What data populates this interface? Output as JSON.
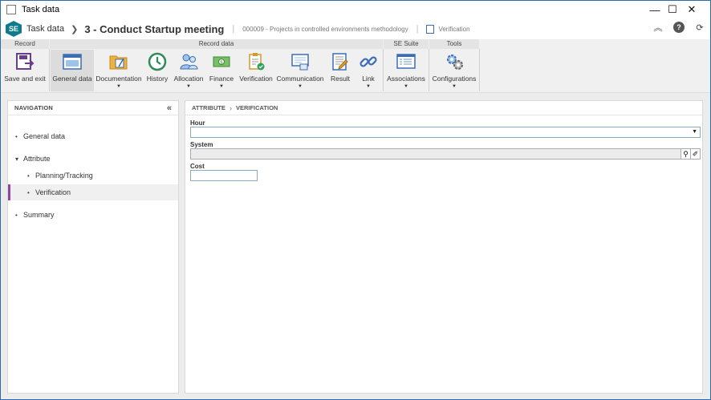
{
  "window": {
    "title": "Task data",
    "controls": {
      "minimize": "—",
      "maximize": "☐",
      "close": "✕"
    }
  },
  "header": {
    "logo_text": "SE",
    "section": "Task data",
    "task_title": "3 - Conduct Startup meeting",
    "project": "000009 - Projects in controlled environments methodology",
    "current_view": "Verification",
    "icons": {
      "collapse": "︽",
      "help": "?",
      "refresh": "⟳"
    }
  },
  "ribbon": {
    "groups": [
      {
        "label": "Record"
      },
      {
        "label": "Record data"
      },
      {
        "label": "SE Suite"
      },
      {
        "label": "Tools"
      }
    ],
    "buttons": [
      {
        "label": "Save and exit",
        "icon": "save-exit-icon",
        "dropdown": false
      },
      {
        "label": "General data",
        "icon": "general-data-icon",
        "dropdown": false,
        "active": true
      },
      {
        "label": "Documentation",
        "icon": "documentation-icon",
        "dropdown": true
      },
      {
        "label": "History",
        "icon": "history-icon",
        "dropdown": false
      },
      {
        "label": "Allocation",
        "icon": "allocation-icon",
        "dropdown": true
      },
      {
        "label": "Finance",
        "icon": "finance-icon",
        "dropdown": true
      },
      {
        "label": "Verification",
        "icon": "verification-icon",
        "dropdown": false
      },
      {
        "label": "Communication",
        "icon": "communication-icon",
        "dropdown": true
      },
      {
        "label": "Result",
        "icon": "result-icon",
        "dropdown": false
      },
      {
        "label": "Link",
        "icon": "link-icon",
        "dropdown": true
      },
      {
        "label": "Associations",
        "icon": "associations-icon",
        "dropdown": true
      },
      {
        "label": "Configurations",
        "icon": "configurations-icon",
        "dropdown": true
      }
    ],
    "dropdown_arrow": "▼"
  },
  "navigation": {
    "heading": "NAVIGATION",
    "collapse_glyph": "«",
    "items": [
      {
        "label": "General data",
        "bullet": "•"
      },
      {
        "label": "Attribute",
        "bullet": "▾"
      },
      {
        "label": "Planning/Tracking",
        "bullet": "•"
      },
      {
        "label": "Verification",
        "bullet": "•"
      },
      {
        "label": "Summary",
        "bullet": "•"
      }
    ]
  },
  "panel": {
    "breadcrumb": [
      "ATTRIBUTE",
      "VERIFICATION"
    ],
    "breadcrumb_sep": "›",
    "fields": {
      "hour": {
        "label": "Hour",
        "value": ""
      },
      "system": {
        "label": "System",
        "value": ""
      },
      "cost": {
        "label": "Cost",
        "value": ""
      }
    },
    "glyphs": {
      "dropdown": "▼",
      "search": "⚲",
      "clear": "✐"
    }
  }
}
